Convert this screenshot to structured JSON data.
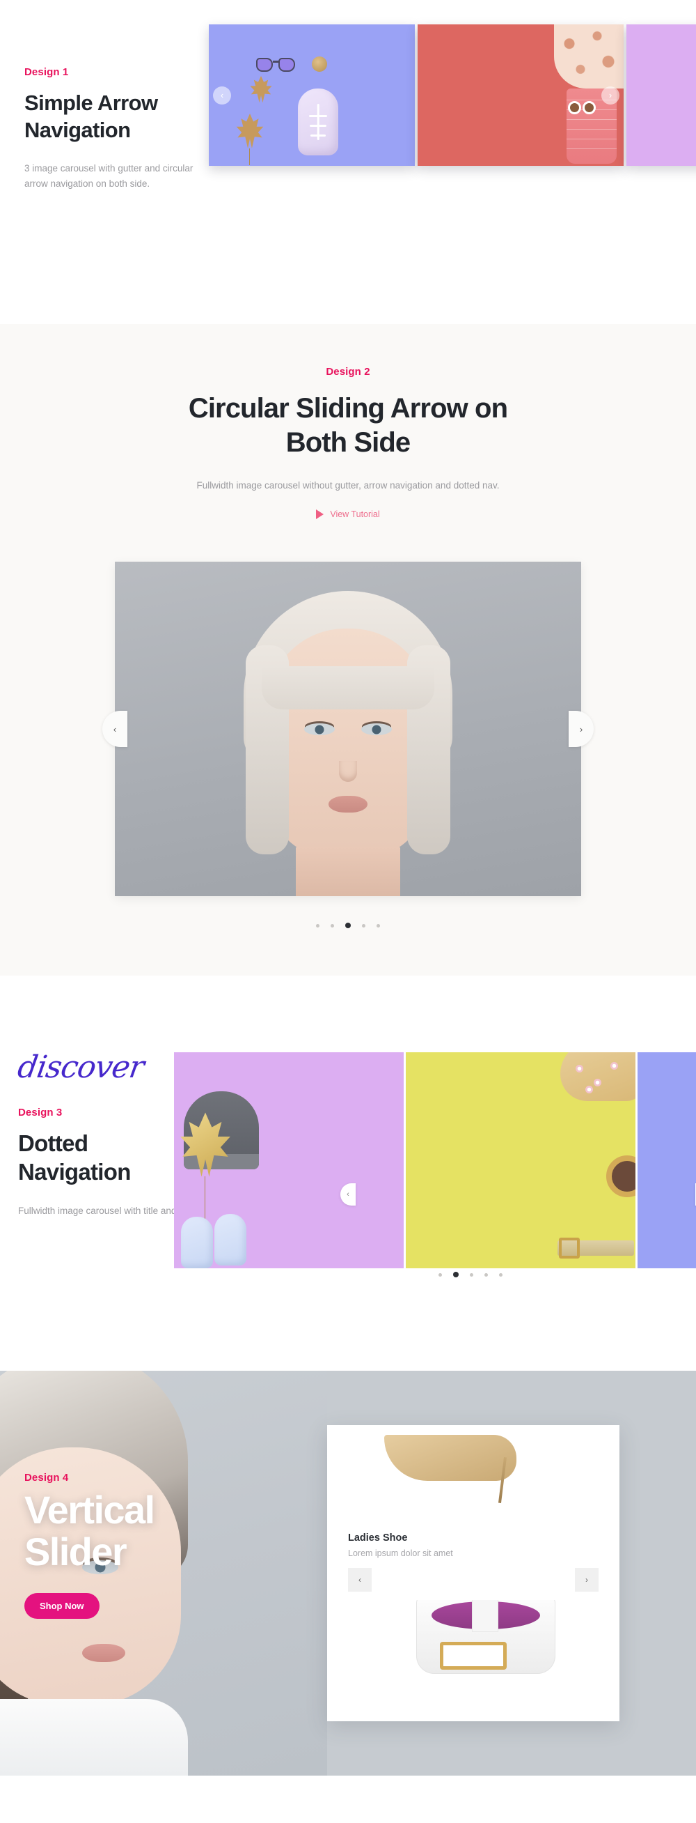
{
  "sections": [
    {
      "eyebrow": "Design 1",
      "title_line1": "Simple Arrow",
      "title_line2": "Navigation",
      "description": "3 image carousel with gutter and circular arrow navigation on both side.",
      "prev_icon": "chevron-left-icon",
      "next_icon": "chevron-right-icon"
    },
    {
      "eyebrow": "Design 2",
      "title_line1": "Circular Sliding Arrow on",
      "title_line2": "Both Side",
      "description": "Fullwidth image carousel without gutter, arrow navigation and dotted nav.",
      "tutorial_label": "View Tutorial",
      "tutorial_icon": "play-icon",
      "prev_icon": "chevron-left-icon",
      "next_icon": "chevron-right-icon",
      "dots": {
        "count": 5,
        "active_index": 2
      }
    },
    {
      "script_word": "discover",
      "eyebrow": "Design 3",
      "title_line1": "Dotted",
      "title_line2": "Navigation",
      "description": "Fullwidth image carousel with title and subtitle.",
      "prev_icon": "chevron-left-icon",
      "next_icon": "chevron-right-icon",
      "dots": {
        "count": 5,
        "active_index": 1
      }
    },
    {
      "eyebrow": "Design 4",
      "title_line1": "Vertical",
      "title_line2": "Slider",
      "cta_label": "Shop Now",
      "card": {
        "title": "Ladies Shoe",
        "subtitle": "Lorem ipsum dolor sit amet",
        "prev_icon": "chevron-left-icon",
        "next_icon": "chevron-right-icon"
      }
    }
  ],
  "icons": {
    "chevron_left": "‹",
    "chevron_right": "›"
  },
  "colors": {
    "accent_pink": "#e8125c",
    "tutorial_pink": "#ee6e8d",
    "script_purple": "#4628cc",
    "cta_pink": "#e4127f",
    "heading_dark": "#22262c",
    "muted_text": "#9a9a9e",
    "section2_bg": "#faf9f7",
    "section4_bg": "#c6cbd0"
  }
}
